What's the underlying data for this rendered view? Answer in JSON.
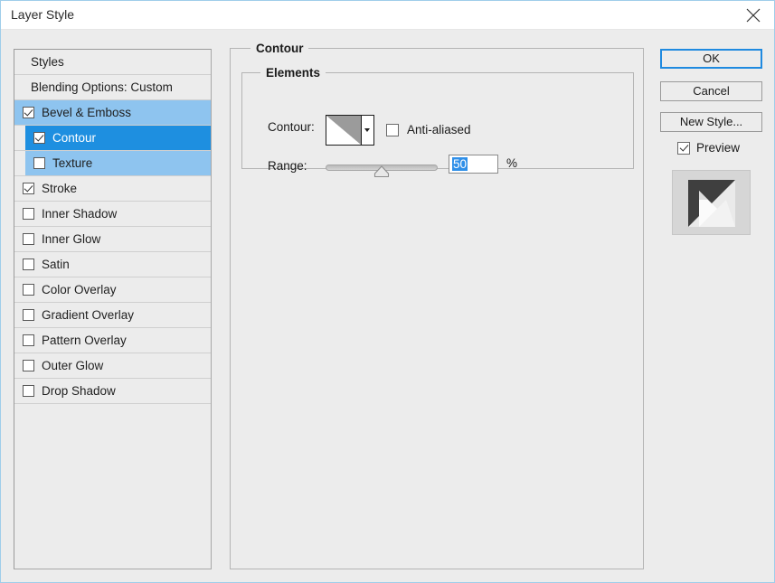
{
  "window": {
    "title": "Layer Style",
    "close_icon": "close-icon"
  },
  "styles_list": {
    "header": "Styles",
    "blending_options": "Blending Options: Custom",
    "effects": [
      {
        "label": "Bevel & Emboss",
        "checked": true,
        "selected": "light",
        "sub": false
      },
      {
        "label": "Contour",
        "checked": true,
        "selected": "strong",
        "sub": true
      },
      {
        "label": "Texture",
        "checked": false,
        "selected": "light",
        "sub": true
      },
      {
        "label": "Stroke",
        "checked": true,
        "selected": "none",
        "sub": false
      },
      {
        "label": "Inner Shadow",
        "checked": false,
        "selected": "none",
        "sub": false
      },
      {
        "label": "Inner Glow",
        "checked": false,
        "selected": "none",
        "sub": false
      },
      {
        "label": "Satin",
        "checked": false,
        "selected": "none",
        "sub": false
      },
      {
        "label": "Color Overlay",
        "checked": false,
        "selected": "none",
        "sub": false
      },
      {
        "label": "Gradient Overlay",
        "checked": false,
        "selected": "none",
        "sub": false
      },
      {
        "label": "Pattern Overlay",
        "checked": false,
        "selected": "none",
        "sub": false
      },
      {
        "label": "Outer Glow",
        "checked": false,
        "selected": "none",
        "sub": false
      },
      {
        "label": "Drop Shadow",
        "checked": false,
        "selected": "none",
        "sub": false
      }
    ]
  },
  "panel": {
    "title": "Contour",
    "elements_group": {
      "title": "Elements",
      "contour_label": "Contour:",
      "contour_preset": "linear-contour",
      "anti_aliased_label": "Anti-aliased",
      "anti_aliased_checked": false,
      "range_label": "Range:",
      "range_value": "50",
      "range_unit": "%",
      "range_percent": 50
    }
  },
  "buttons": {
    "ok": "OK",
    "cancel": "Cancel",
    "new_style": "New Style...",
    "preview_label": "Preview",
    "preview_checked": true
  },
  "colors": {
    "window_border": "#9fcdea",
    "dialog_bg": "#ececec",
    "selection_strong": "#1e8fe0",
    "selection_light": "#8ec4ef",
    "focus_border": "#1f8ae0",
    "text_selection": "#2f8fe8"
  }
}
